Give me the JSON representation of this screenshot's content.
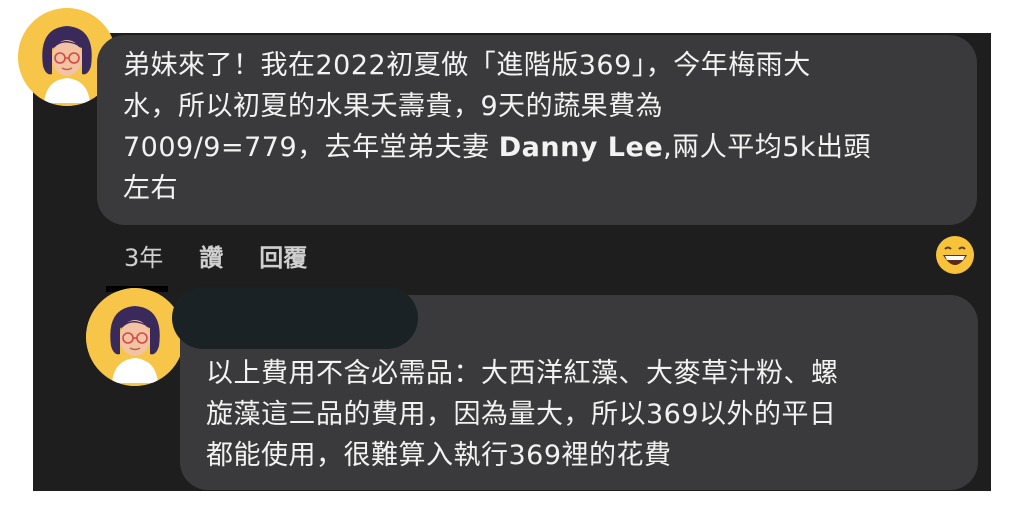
{
  "comment1": {
    "text_before": "弟妹來了！我在2022初夏做「進階版369」，今年梅雨大\n水，所以初夏的水果夭壽貴，9天的蔬果費為\n7009/9=779，去年堂弟夫妻 ",
    "mention": "Danny Lee",
    "text_after": ",兩人平均5k出頭\n左右",
    "time": "3年",
    "like_label": "讚",
    "reply_label": "回覆",
    "reaction_icon": "grinning-face-emoji"
  },
  "comment2": {
    "text": "以上費用不含必需品：大西洋紅藻、大麥草汁粉、螺\n旋藻這三品的費用，因為量大，所以369以外的平日\n都能使用，很難算入執行369裡的花費"
  },
  "colors": {
    "background": "#1e1e1e",
    "bubble": "#3a3a3c",
    "avatar_bg": "#f7c548",
    "text": "#f2f2f2"
  }
}
